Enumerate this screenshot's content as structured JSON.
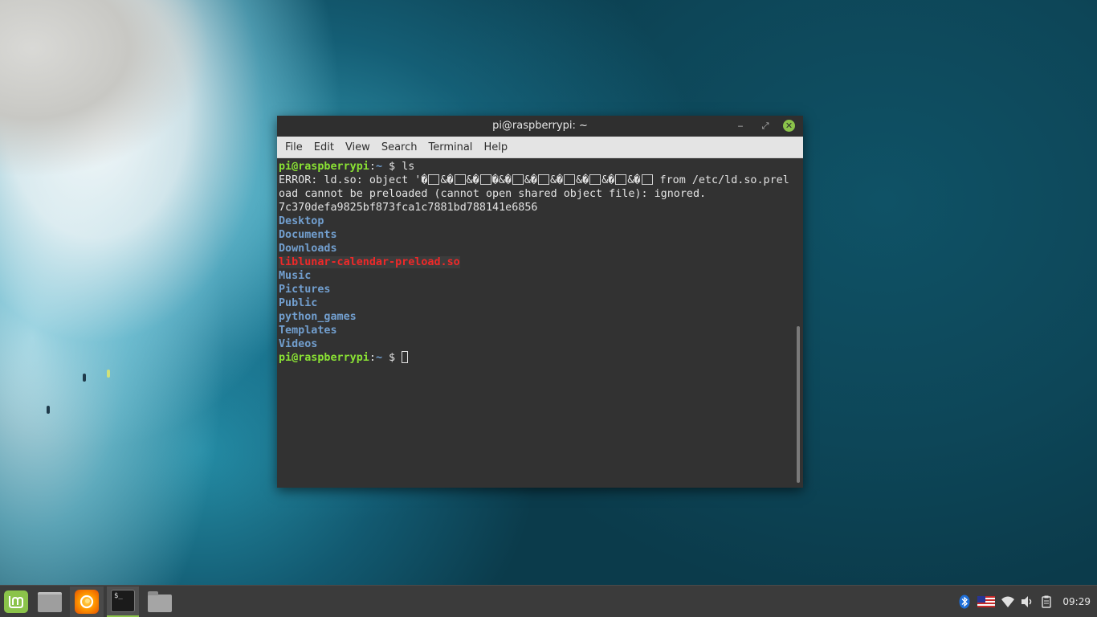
{
  "window": {
    "title": "pi@raspberrypi: ~",
    "minimize": "‒",
    "maximize": "⤢",
    "close": "✕"
  },
  "menu": [
    "File",
    "Edit",
    "View",
    "Search",
    "Terminal",
    "Help"
  ],
  "terminal": {
    "prompt_user": "pi@raspberrypi",
    "prompt_sep": ":",
    "prompt_path": "~",
    "prompt_symbol": " $ ",
    "command": "ls",
    "error_before": "ERROR: ld.so: object '",
    "error_garble": [
      "�",
      "&�",
      "&�",
      "�&�",
      "&�",
      "&�",
      "&�",
      "&�",
      "&�"
    ],
    "error_after": " from /etc/ld.so.preload cannot be preloaded (cannot open shared object file): ignored.",
    "ls_left": [
      {
        "name": "7c370defa9825bf873fca1c7881bd788141e6856",
        "kind": "file"
      },
      {
        "name": "Desktop",
        "kind": "dir"
      },
      {
        "name": "Documents",
        "kind": "dir"
      },
      {
        "name": "Downloads",
        "kind": "dir"
      },
      {
        "name": "liblunar-calendar-preload.so",
        "kind": "broken"
      },
      {
        "name": "Music",
        "kind": "dir"
      }
    ],
    "ls_right": [
      {
        "name": "Pictures",
        "kind": "dir"
      },
      {
        "name": "Public",
        "kind": "dir"
      },
      {
        "name": "python_games",
        "kind": "dir"
      },
      {
        "name": "Templates",
        "kind": "dir"
      },
      {
        "name": "Videos",
        "kind": "dir"
      }
    ]
  },
  "taskbar": {
    "clock": "09:29",
    "terminal_icon_text": "$_"
  },
  "colors": {
    "prompt_user": "#8ae234",
    "dir": "#729fcf",
    "broken": "#ef2929",
    "mint_green": "#8bc34a"
  }
}
